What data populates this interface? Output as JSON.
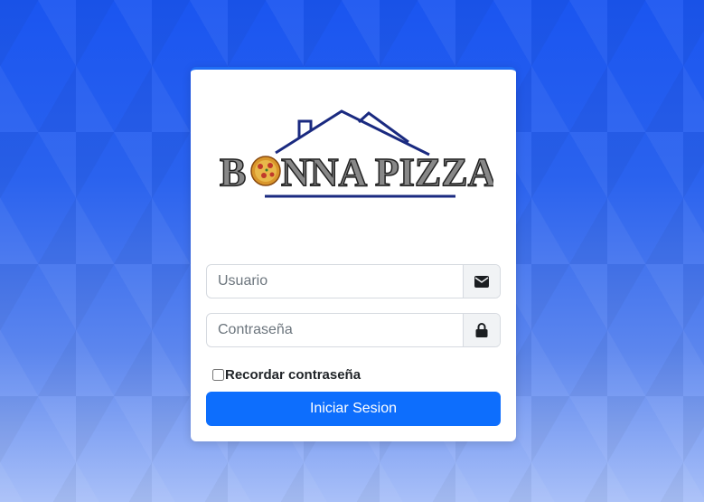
{
  "brand": {
    "logo_text_part1": "B",
    "logo_text_part2": "NNA PIZZA"
  },
  "login": {
    "username_placeholder": "Usuario",
    "password_placeholder": "Contraseña",
    "remember_label": "Recordar contraseña",
    "submit_label": "Iniciar Sesion"
  },
  "icons": {
    "username": "envelope-icon",
    "password": "lock-icon"
  },
  "colors": {
    "primary": "#0d6efd",
    "logo_navy": "#1a2a80",
    "background_top": "#1a55f0"
  }
}
